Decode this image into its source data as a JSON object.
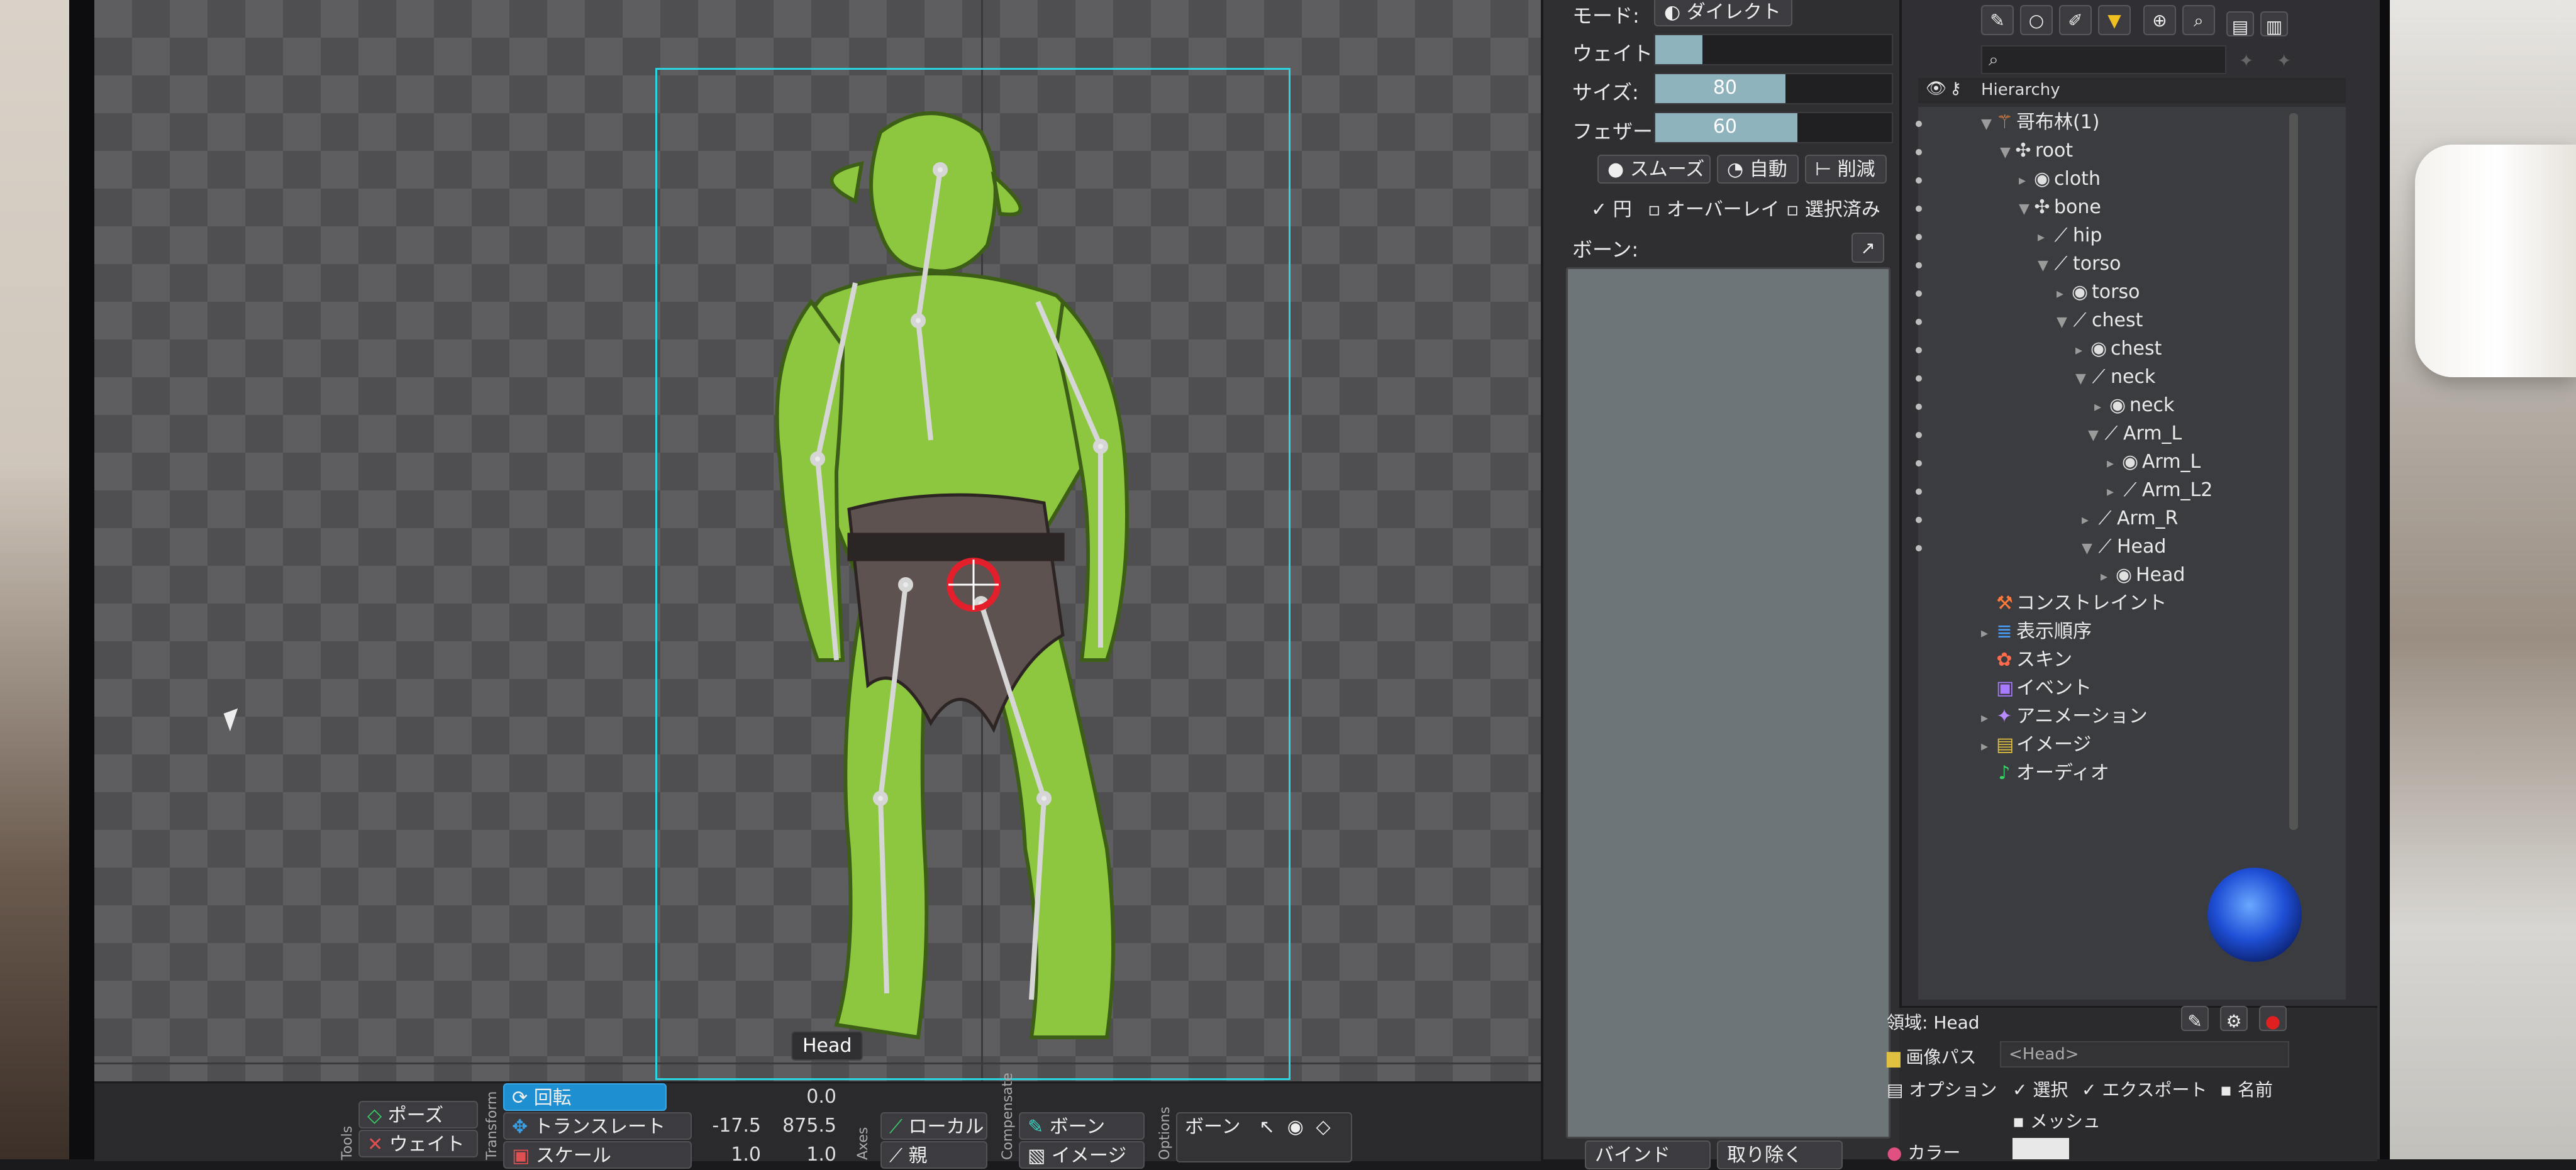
{
  "viewport": {
    "bone_label": "Head"
  },
  "bottom_toolbar": {
    "tools_label": "Tools",
    "transform_label": "Transform",
    "axes_label": "Axes",
    "compensate_label": "Compensate",
    "options_label": "Options",
    "pose_button": "ポーズ",
    "weight_button": "ウェイト",
    "rotate_label": "回転",
    "rotate_value": "0.0",
    "translate_label": "トランスレート",
    "translate_x": "-17.5",
    "translate_y": "875.5",
    "scale_label": "スケール",
    "scale_x": "1.0",
    "scale_y": "1.0",
    "local_button": "ローカル",
    "axes_second_button": "親",
    "bone_button": "ボーン",
    "image_button": "イメージ",
    "options_bone_label": "ボーン"
  },
  "mesh_tools": {
    "mode_label": "モード:",
    "mode_value": "ダイレクト",
    "weight_label": "ウェイト:",
    "size_label": "サイズ:",
    "size_value": "80",
    "size_fraction": 0.55,
    "feather_label": "フェザー:",
    "feather_value": "60",
    "feather_fraction": 0.6,
    "weight_fraction": 0.2,
    "smooth_button": "スムーズ",
    "auto_button": "自動",
    "prune_button": "削減",
    "circle_option": "円",
    "overlay_option": "オーバーレイ",
    "selected_option": "選択済み",
    "bones_label": "ボーン:",
    "bind_button": "バインド",
    "remove_button": "取り除く"
  },
  "tree": {
    "search_placeholder": "",
    "header": "Hierarchy",
    "items": [
      {
        "label": "哥布林(1)",
        "icon": "skeleton-icon"
      },
      {
        "label": "root",
        "icon": "bone-root-icon"
      },
      {
        "label": "cloth",
        "icon": "slot-icon"
      },
      {
        "label": "bone",
        "icon": "bone-root-icon"
      },
      {
        "label": "hip",
        "icon": "bone-icon"
      },
      {
        "label": "torso",
        "icon": "bone-icon"
      },
      {
        "label": "torso",
        "icon": "slot-icon"
      },
      {
        "label": "chest",
        "icon": "bone-icon"
      },
      {
        "label": "chest",
        "icon": "slot-icon"
      },
      {
        "label": "neck",
        "icon": "bone-icon"
      },
      {
        "label": "neck",
        "icon": "slot-icon"
      },
      {
        "label": "Arm_L",
        "icon": "bone-icon"
      },
      {
        "label": "Arm_L",
        "icon": "slot-icon"
      },
      {
        "label": "Arm_L2",
        "icon": "bone-icon"
      },
      {
        "label": "Arm_R",
        "icon": "bone-icon"
      },
      {
        "label": "Head",
        "icon": "bone-icon"
      },
      {
        "label": "Head",
        "icon": "slot-icon"
      },
      {
        "label": "コンストレイント",
        "icon": "constraint-icon"
      },
      {
        "label": "表示順序",
        "icon": "draw-order-icon"
      },
      {
        "label": "スキン",
        "icon": "skin-icon"
      },
      {
        "label": "イベント",
        "icon": "event-icon"
      },
      {
        "label": "アニメーション",
        "icon": "animation-icon"
      },
      {
        "label": "イメージ",
        "icon": "image-icon"
      },
      {
        "label": "オーディオ",
        "icon": "audio-icon"
      }
    ]
  },
  "properties": {
    "slot_label": "領域: Head",
    "image_path_label": "画像パス",
    "image_path_value": "<Head>",
    "options_label": "オプション",
    "select_option": "選択",
    "export_option": "エクスポート",
    "name_option": "名前",
    "mesh_option": "メッシュ",
    "color_label": "カラー"
  }
}
